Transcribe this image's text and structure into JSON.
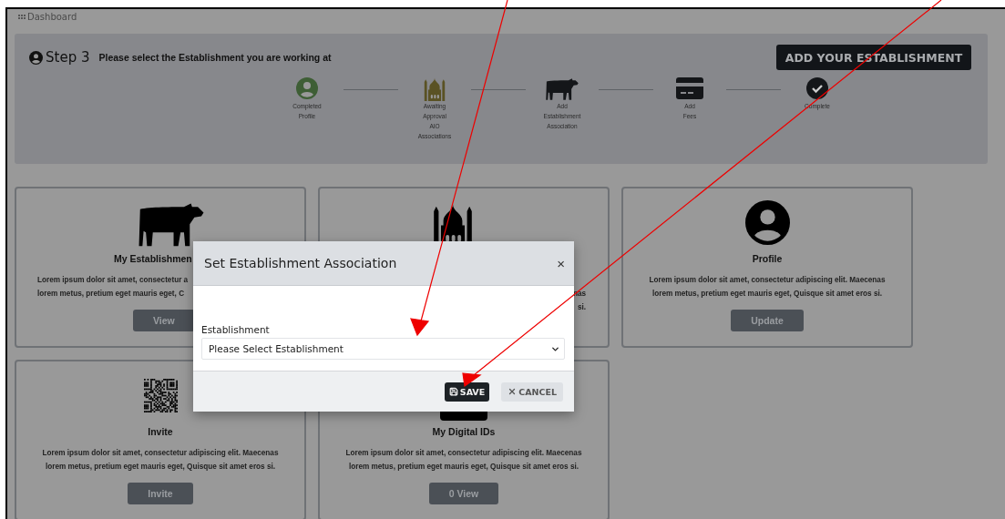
{
  "breadcrumb": {
    "label": "Dashboard"
  },
  "step_panel": {
    "step": "Step 3",
    "instruction": "Please select the Establishment you are working at",
    "button": "ADD YOUR ESTABLISHMENT",
    "steps": [
      {
        "kind": "profile",
        "label_lines": [
          "Completed",
          "Profile"
        ],
        "color": "#3e5e35"
      },
      {
        "kind": "mosque",
        "label_lines": [
          "Awaiting",
          "Approval",
          "AIO",
          "Associations"
        ],
        "color": "#5a5224"
      },
      {
        "kind": "cow",
        "label_lines": [
          "Add",
          "Establishment",
          "Association"
        ],
        "color": "#141619"
      },
      {
        "kind": "card",
        "label_lines": [
          "Add",
          "Fees"
        ],
        "color": "#141619"
      },
      {
        "kind": "check",
        "label_lines": [
          "Complete"
        ],
        "color": "#141619"
      }
    ]
  },
  "cards": [
    {
      "kind": "cow",
      "title": "My Establishmen",
      "description_lines": [
        "Lorem ipsum dolor sit amet, consectetur a",
        "lorem metus, pretium eget mauris eget, C"
      ],
      "button": "View"
    },
    {
      "kind": "mosque",
      "description_lines": [
        "nas",
        "si."
      ]
    },
    {
      "kind": "profile",
      "title": "Profile",
      "description_lines": [
        "Lorem ipsum dolor sit amet, consectetur adipiscing elit. Maecenas",
        "lorem metus, pretium eget mauris eget, Quisque sit amet eros si."
      ],
      "button": "Update"
    },
    {
      "kind": "qr",
      "title": "Invite",
      "description_lines": [
        "Lorem ipsum dolor sit amet, consectetur adipiscing elit. Maecenas",
        "lorem metus, pretium eget mauris eget, Quisque sit amet eros si."
      ],
      "button": "Invite"
    },
    {
      "kind": "id",
      "title": "My Digital IDs",
      "description_lines": [
        "Lorem ipsum dolor sit amet, consectetur adipiscing elit. Maecenas",
        "lorem metus, pretium eget mauris eget, Quisque sit amet eros si."
      ],
      "button": "0 View"
    }
  ],
  "modal": {
    "title": "Set Establishment Association",
    "close": "×",
    "field_label": "Establishment",
    "select_value": "Please Select Establishment",
    "save": "SAVE",
    "cancel": "CANCEL"
  }
}
